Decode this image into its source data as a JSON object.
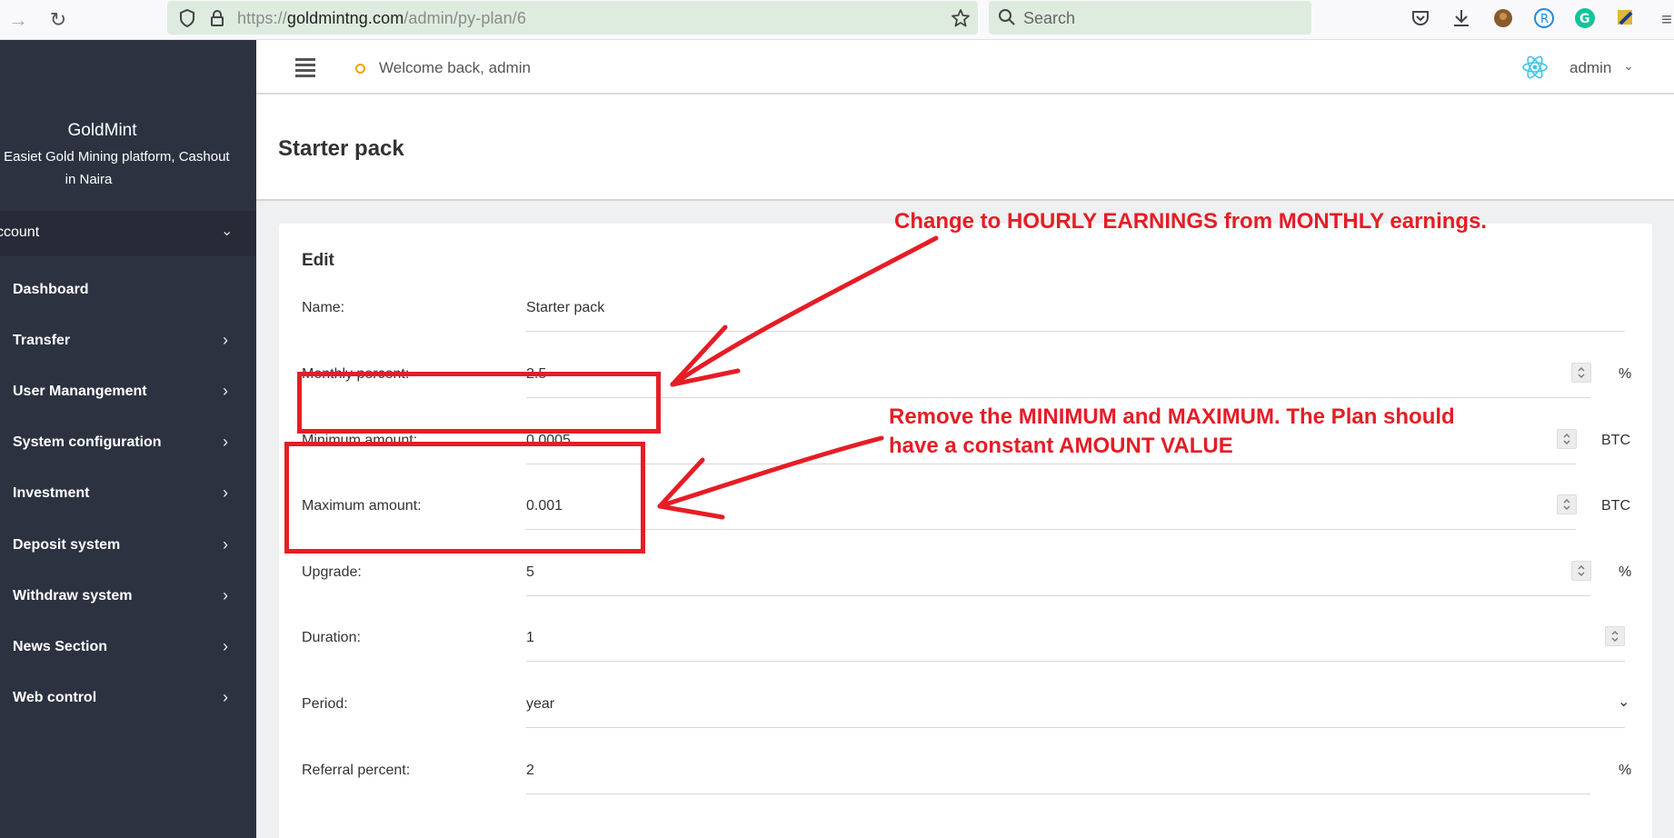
{
  "browser": {
    "url_prefix": "https://",
    "url_domain": "goldmintng.com",
    "url_path": "/admin/py-plan/6",
    "search_placeholder": "Search"
  },
  "sidebar": {
    "brand": "GoldMint",
    "tagline": "gest and Easiet Gold Mining platform, Cashout in Naira",
    "account_label": "ccount",
    "items": [
      {
        "label": "Dashboard"
      },
      {
        "label": "Transfer"
      },
      {
        "label": "User Manangement"
      },
      {
        "label": "System configuration"
      },
      {
        "label": "Investment"
      },
      {
        "label": "Deposit system"
      },
      {
        "label": "Withdraw system"
      },
      {
        "label": "News Section"
      },
      {
        "label": "Web control"
      }
    ]
  },
  "header": {
    "welcome": "Welcome back, admin",
    "user": "admin"
  },
  "page": {
    "title": "Starter pack",
    "card_title": "Edit"
  },
  "form": {
    "fields": [
      {
        "label": "Name:",
        "value": "Starter pack",
        "unit": ""
      },
      {
        "label": "Monthly percent:",
        "value": "2.5",
        "unit": "%"
      },
      {
        "label": "Minimum amount:",
        "value": "0.0005",
        "unit": "BTC"
      },
      {
        "label": "Maximum amount:",
        "value": "0.001",
        "unit": "BTC"
      },
      {
        "label": "Upgrade:",
        "value": "5",
        "unit": "%"
      },
      {
        "label": "Duration:",
        "value": "1",
        "unit": ""
      },
      {
        "label": "Period:",
        "value": "year",
        "unit": ""
      },
      {
        "label": "Referral percent:",
        "value": "2",
        "unit": "%"
      }
    ]
  },
  "annotations": {
    "note1": "Change to HOURLY EARNINGS from MONTHLY earnings.",
    "note2_line1": "Remove the MINIMUM and MAXIMUM. The Plan should",
    "note2_line2": "have a constant AMOUNT VALUE",
    "color": "#e51d25"
  },
  "colors": {
    "sidebar_bg": "#2c3240",
    "content_bg": "#eef0f2",
    "url_bar_bg": "#ddecdf",
    "status_dot": "#f0a500"
  }
}
